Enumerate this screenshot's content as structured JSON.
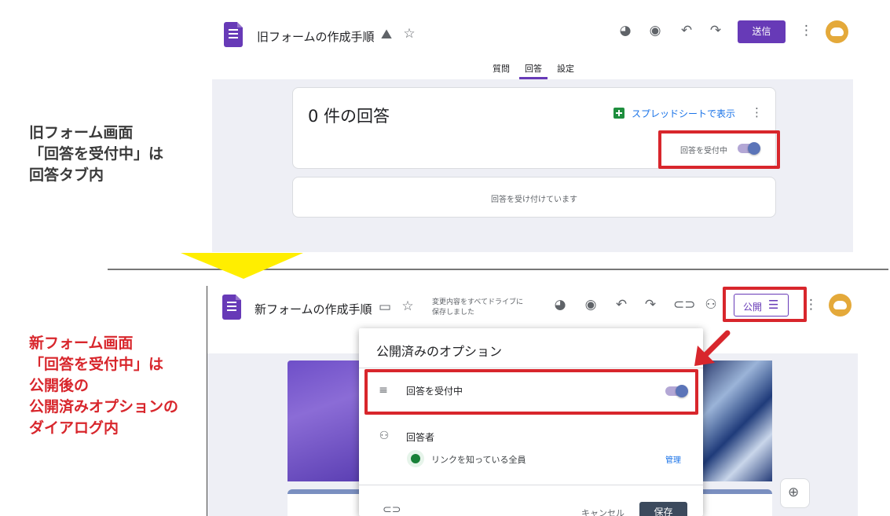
{
  "old_form": {
    "title": "旧フォームの作成手順",
    "send_label": "送信",
    "tabs": [
      "質問",
      "回答",
      "設定"
    ],
    "active_tab": "回答",
    "responses_heading": "0 件の回答",
    "sheets_link": "スプレッドシートで表示",
    "accepting_label": "回答を受付中",
    "accepting_message": "回答を受け付けています"
  },
  "annotations": {
    "old": [
      "旧フォーム画面",
      "「回答を受付中」は",
      "回答タブ内"
    ],
    "new": [
      "新フォーム画面",
      "「回答を受付中」は",
      "公開後の",
      "公開済みオプションの",
      "ダイアログ内"
    ]
  },
  "new_form": {
    "title": "新フォームの作成手順",
    "saved_status": [
      "変更内容をすべてドライブに",
      "保存しました"
    ],
    "publish_label": "公開"
  },
  "dialog": {
    "title": "公開済みのオプション",
    "accepting_label": "回答を受付中",
    "responders_label": "回答者",
    "link_access": "リンクを知っている全員",
    "manage_link": "管理",
    "cancel_label": "キャンセル",
    "save_label": "保存"
  },
  "colors": {
    "accent": "#673ab7",
    "highlight_red": "#d8262c",
    "arrow_yellow": "#ffee00",
    "annotation_dark": "#202124",
    "annotation_red": "#d8262c"
  }
}
